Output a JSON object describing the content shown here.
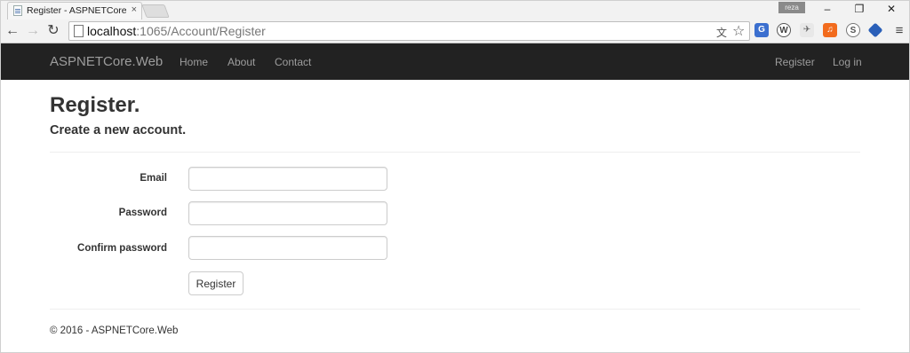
{
  "browser": {
    "tab_title": "Register - ASPNETCore.W...",
    "tab_close": "×",
    "profile_label": "reza",
    "address": {
      "host": "localhost",
      "path": ":1065/Account/Register"
    },
    "window_controls": {
      "minimize": "–",
      "restore": "❐",
      "close": "✕"
    },
    "nav": {
      "back": "←",
      "forward": "→",
      "reload": "↻"
    },
    "omnibox_icons": {
      "translate": "文",
      "bookmark_star": "☆"
    },
    "extensions": [
      "translate-ext-icon",
      "wordpress-ext-icon",
      "flight-ext-icon",
      "music-ext-icon",
      "skype-ext-icon",
      "feedly-ext-icon"
    ],
    "menu": "≡"
  },
  "navbar": {
    "brand": "ASPNETCore.Web",
    "links": [
      "Home",
      "About",
      "Contact"
    ],
    "right_links": [
      "Register",
      "Log in"
    ]
  },
  "page": {
    "title": "Register.",
    "subtitle": "Create a new account.",
    "fields": [
      {
        "label": "Email",
        "value": ""
      },
      {
        "label": "Password",
        "value": ""
      },
      {
        "label": "Confirm password",
        "value": ""
      }
    ],
    "submit_label": "Register",
    "footer": "© 2016 - ASPNETCore.Web"
  },
  "colors": {
    "navbar_bg": "#222222",
    "nav_text": "#9d9d9d",
    "body_text": "#333333"
  }
}
